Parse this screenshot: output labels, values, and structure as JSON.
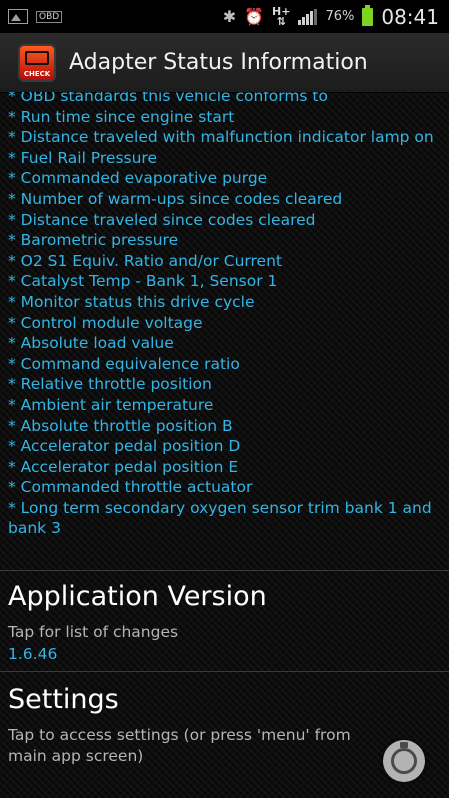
{
  "status_bar": {
    "obd_label": "OBD",
    "network": "H+",
    "battery": "76%",
    "time": "08:41"
  },
  "app_bar": {
    "logo_text": "CHECK",
    "title": "Adapter Status Information"
  },
  "pids": [
    "* OBD standards this vehicle conforms to",
    "* Run time since engine start",
    "* Distance traveled with malfunction indicator lamp on",
    "* Fuel Rail Pressure",
    "* Commanded evaporative purge",
    "* Number of warm-ups since codes cleared",
    "* Distance traveled since codes cleared",
    "* Barometric pressure",
    "* O2 S1 Equiv. Ratio and/or Current",
    "* Catalyst Temp - Bank 1, Sensor 1",
    "* Monitor status this drive cycle",
    "* Control module voltage",
    "* Absolute load value",
    "* Command equivalence ratio",
    "* Relative throttle position",
    "* Ambient air temperature",
    "* Absolute throttle position B",
    "* Accelerator pedal position D",
    "* Accelerator pedal position E",
    "* Commanded throttle actuator",
    "* Long term secondary oxygen sensor trim bank 1 and bank 3"
  ],
  "app_version": {
    "title": "Application Version",
    "subtitle": "Tap for list of changes",
    "version": "1.6.46"
  },
  "settings": {
    "title": "Settings",
    "subtitle": "Tap to access settings (or press 'menu' from main app screen)"
  },
  "colors": {
    "accent": "#33b5e5",
    "battery": "#7ed321"
  }
}
